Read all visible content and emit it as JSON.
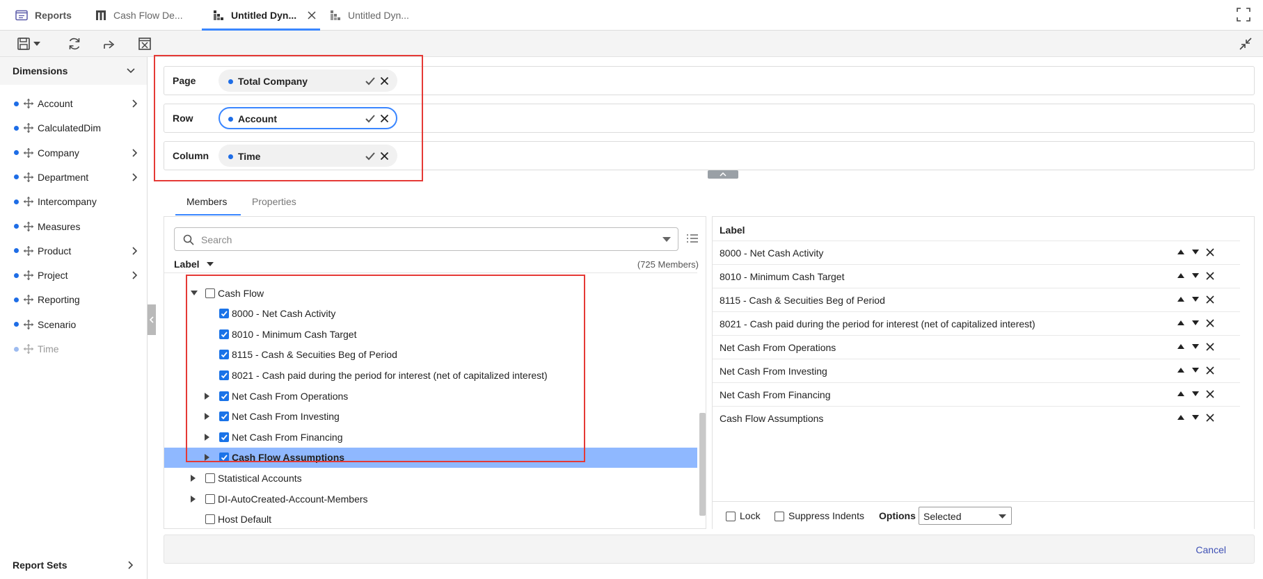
{
  "tabs": [
    {
      "label": "Reports",
      "icon": "reports-icon"
    },
    {
      "label": "Cash Flow De...",
      "icon": "grid-icon"
    },
    {
      "label": "Untitled Dyn...",
      "icon": "dynamic-report-icon",
      "active": true
    },
    {
      "label": "Untitled Dyn...",
      "icon": "dynamic-report-icon"
    }
  ],
  "sidebar": {
    "header": "Dimensions",
    "items": [
      {
        "label": "Account",
        "has_children": true
      },
      {
        "label": "CalculatedDim",
        "has_children": false
      },
      {
        "label": "Company",
        "has_children": true
      },
      {
        "label": "Department",
        "has_children": true
      },
      {
        "label": "Intercompany",
        "has_children": false
      },
      {
        "label": "Measures",
        "has_children": false
      },
      {
        "label": "Product",
        "has_children": true
      },
      {
        "label": "Project",
        "has_children": true
      },
      {
        "label": "Reporting",
        "has_children": false
      },
      {
        "label": "Scenario",
        "has_children": false
      },
      {
        "label": "Time",
        "has_children": false,
        "disabled": true
      }
    ],
    "footer": "Report Sets"
  },
  "layout": {
    "page": {
      "label": "Page",
      "value": "Total Company"
    },
    "row": {
      "label": "Row",
      "value": "Account"
    },
    "column": {
      "label": "Column",
      "value": "Time"
    }
  },
  "panel_tabs": {
    "members": "Members",
    "properties": "Properties"
  },
  "members": {
    "search_placeholder": "Search",
    "label_header": "Label",
    "count": "(725 Members)",
    "tree": [
      {
        "label": "Cash Flow",
        "level": 0,
        "expand": "open",
        "checked": false
      },
      {
        "label": "8000 - Net Cash Activity",
        "level": 1,
        "expand": "none",
        "checked": true
      },
      {
        "label": "8010 - Minimum Cash Target",
        "level": 1,
        "expand": "none",
        "checked": true
      },
      {
        "label": "8115 - Cash & Secuities Beg of Period",
        "level": 1,
        "expand": "none",
        "checked": true
      },
      {
        "label": "8021 - Cash paid during the period for interest (net of capitalized interest)",
        "level": 1,
        "expand": "none",
        "checked": true
      },
      {
        "label": "Net Cash From Operations",
        "level": 1,
        "expand": "closed",
        "checked": true
      },
      {
        "label": "Net Cash From Investing",
        "level": 1,
        "expand": "closed",
        "checked": true
      },
      {
        "label": "Net Cash From Financing",
        "level": 1,
        "expand": "closed",
        "checked": true
      },
      {
        "label": "Cash Flow Assumptions",
        "level": 1,
        "expand": "closed",
        "checked": true,
        "selected": true
      },
      {
        "label": "Statistical Accounts",
        "level": 0,
        "expand": "closed",
        "checked": false
      },
      {
        "label": "DI-AutoCreated-Account-Members",
        "level": 0,
        "expand": "closed",
        "checked": false
      },
      {
        "label": "Host Default",
        "level": 0,
        "expand": "none",
        "checked": false
      }
    ]
  },
  "selected": {
    "header": "Label",
    "items": [
      "8000 - Net Cash Activity",
      "8010 - Minimum Cash Target",
      "8115 - Cash & Secuities Beg of Period",
      "8021 - Cash paid during the period for interest (net of capitalized interest)",
      "Net Cash From Operations",
      "Net Cash From Investing",
      "Net Cash From Financing",
      "Cash Flow Assumptions"
    ],
    "footer": {
      "lock": "Lock",
      "suppress": "Suppress Indents",
      "options_label": "Options",
      "options_value": "Selected"
    }
  },
  "bottom": {
    "cancel": "Cancel"
  },
  "colors": {
    "accent": "#3a86ff",
    "highlight": "#e53935",
    "dot": "#1e6de6",
    "selected_row": "#8fb8ff"
  }
}
